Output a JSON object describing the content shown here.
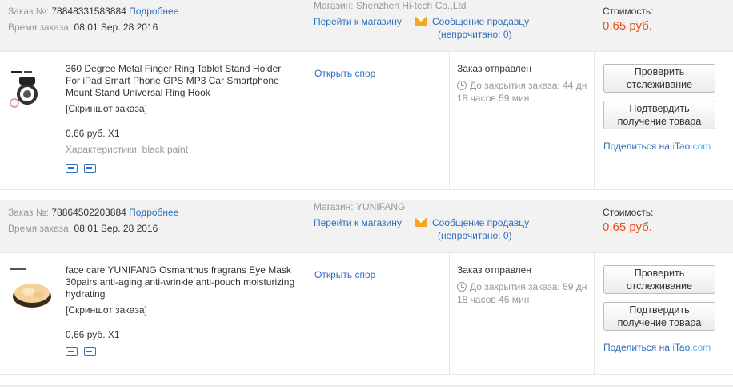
{
  "labels": {
    "order_no": "Заказ №:",
    "details": "Подробнее",
    "order_time": "Время заказа:",
    "store": "Магазин:",
    "go_to_store": "Перейти к магазину",
    "divider": "|",
    "message_seller": "Сообщение продавцу",
    "unread": "(непрочитано: 0)",
    "cost": "Стоимость:",
    "screenshot": "[Скриншот заказа]",
    "characteristics": "Характеристики:",
    "open_dispute": "Открыть спор",
    "track_btn": [
      "Проверить",
      "отслеживание"
    ],
    "confirm_btn": [
      "Подтвердить",
      "получение товара"
    ],
    "share_prefix": "Поделиться на ",
    "share_i": "i",
    "share_tao": "Tao",
    "share_com": ".com"
  },
  "orders": [
    {
      "order_number": "78848331583884",
      "order_time": "08:01 Sep. 28 2016",
      "store_name": "Shenzhen Hi-tech Co.,Ltd",
      "cost": "0,65 руб.",
      "product_title": "360 Degree Metal Finger Ring Tablet Stand Holder For iPad Smart Phone GPS MP3 Car Smartphone Mount Stand Universal Ring Hook",
      "unit_price": "0,66 руб. X1",
      "characteristics_value": "black paint",
      "status": "Заказ отправлен",
      "countdown": "До закрытия заказа: 44 дн 18 часов 59 мин"
    },
    {
      "order_number": "78864502203884",
      "order_time": "08:01 Sep. 28 2016",
      "store_name": "YUNIFANG",
      "cost": "0,65 руб.",
      "product_title": "face care YUNIFANG Osmanthus fragrans Eye Mask 30pairs anti-aging anti-wrinkle anti-pouch moisturizing hydrating",
      "unit_price": "0,66 руб. X1",
      "characteristics_value": "",
      "status": "Заказ отправлен",
      "countdown": "До закрытия заказа: 59 дн 18 часов 46 мин"
    }
  ],
  "colors": {
    "link": "#2f6fbd",
    "price": "#e5501d",
    "header_bg": "#f2f2f2",
    "envelope": "#f5a623",
    "itao_accent": "#5ab0e6"
  },
  "icons": [
    "envelope-icon",
    "clock-icon",
    "shipping-icon",
    "return-icon"
  ]
}
